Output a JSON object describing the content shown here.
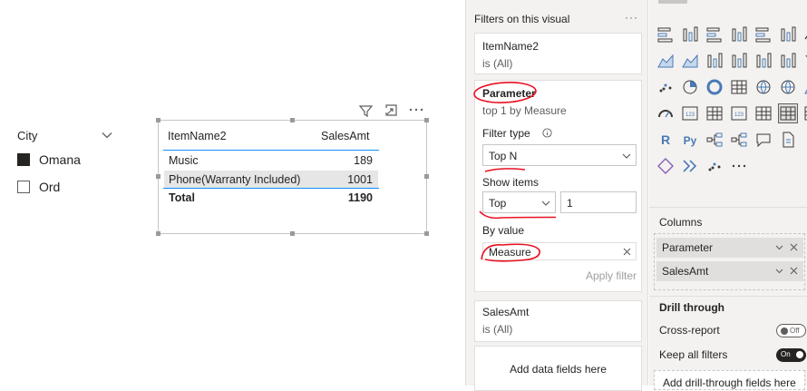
{
  "slicer": {
    "title": "City",
    "items": [
      {
        "label": "Omana",
        "checked": true
      },
      {
        "label": "Ord",
        "checked": false
      }
    ]
  },
  "table": {
    "columns": [
      "ItemName2",
      "SalesAmt"
    ],
    "rows": [
      {
        "name": "Music",
        "value": "189"
      },
      {
        "name": "Phone(Warranty Included)",
        "value": "1001"
      }
    ],
    "total": {
      "name": "Total",
      "value": "1190"
    },
    "header_icons": [
      "filter-icon",
      "focus-mode-icon",
      "more-options-icon"
    ]
  },
  "filters": {
    "title": "Filters on this visual",
    "more": "···",
    "cards": [
      {
        "field": "ItemName2",
        "state": "is (All)"
      },
      {
        "field": "SalesAmt",
        "state": "is (All)"
      }
    ],
    "parameter": {
      "field": "Parameter",
      "summary": "top 1 by Measure",
      "filter_type_label": "Filter type",
      "filter_type_value": "Top N",
      "show_items_label": "Show items",
      "show_items_direction": "Top",
      "show_items_count": "1",
      "by_value_label": "By value",
      "by_value_field": "Measure",
      "apply": "Apply filter"
    },
    "add_fields": "Add data fields here"
  },
  "visualizations": {
    "icons": [
      "stacked-bar-icon",
      "stacked-column-icon",
      "clustered-bar-icon",
      "clustered-column-icon",
      "100-stacked-bar-icon",
      "100-stacked-column-icon",
      "line-chart-icon",
      "area-chart-icon",
      "stacked-area-icon",
      "line-clustered-column-icon",
      "line-stacked-column-icon",
      "ribbon-chart-icon",
      "waterfall-icon",
      "funnel-icon",
      "scatter-icon",
      "pie-chart-icon",
      "donut-chart-icon",
      "treemap-icon",
      "map-icon",
      "filled-map-icon",
      "shape-map-icon",
      "gauge-icon",
      "card-icon",
      "multi-row-card-icon",
      "kpi-icon",
      "slicer-icon",
      "table-icon",
      "matrix-icon",
      "r-visual-icon",
      "python-visual-icon",
      "key-influencers-icon",
      "decomposition-tree-icon",
      "qa-icon",
      "smart-narrative-icon",
      "paginated-report-icon",
      "power-apps-icon",
      "power-automate-icon",
      "arcgis-icon",
      "more-visuals-icon"
    ],
    "columns_label": "Columns",
    "wells": [
      "Parameter",
      "SalesAmt"
    ],
    "drill_through": "Drill through",
    "cross_report": "Cross-report",
    "cross_report_state": "Off",
    "keep_all_filters": "Keep all filters",
    "keep_all_filters_state": "On",
    "drill_add": "Add drill-through fields here"
  }
}
